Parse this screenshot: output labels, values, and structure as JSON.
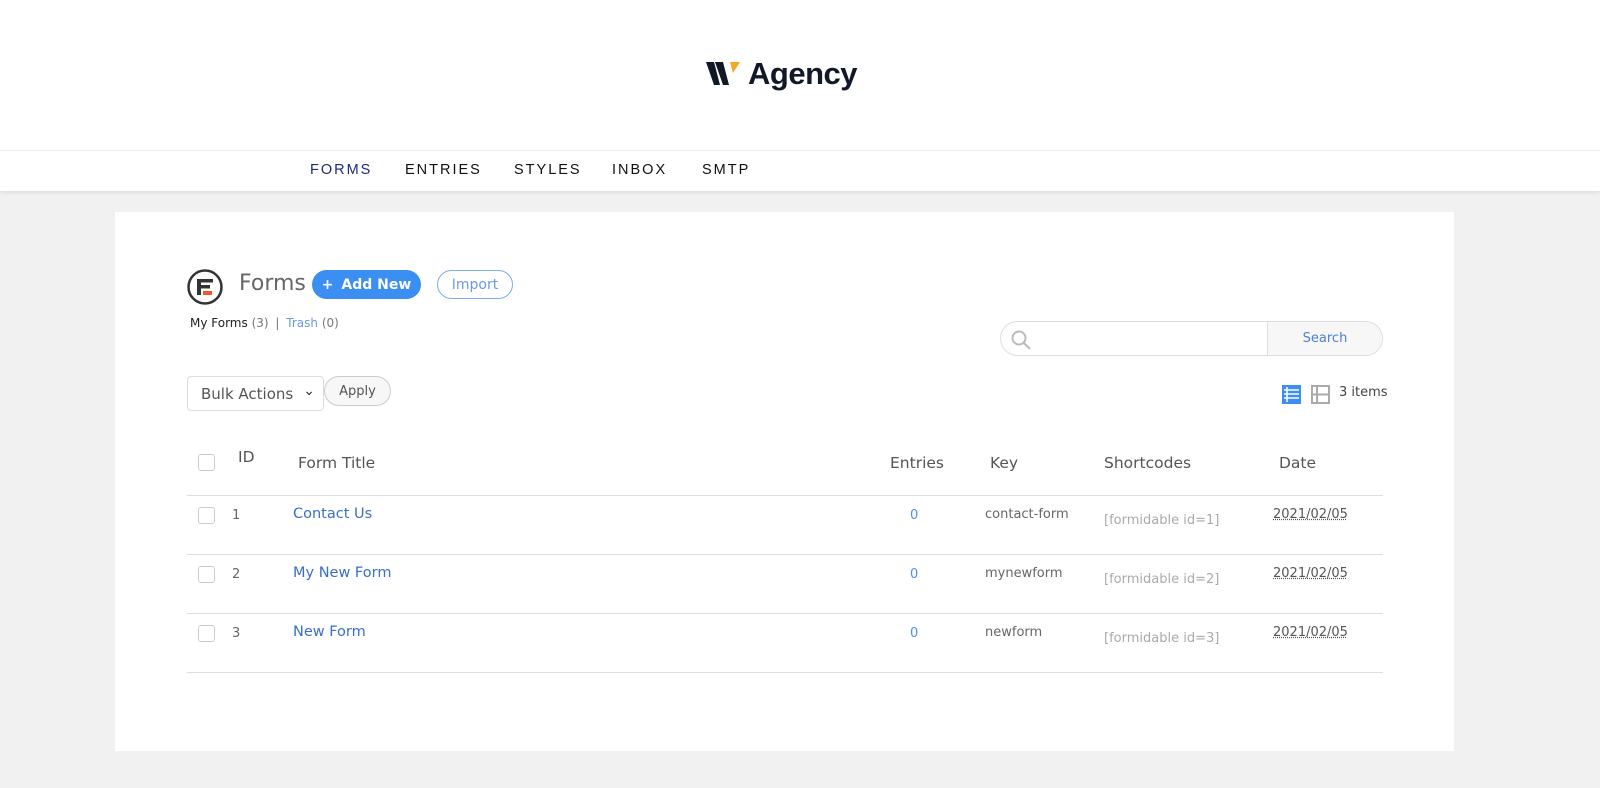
{
  "brand": {
    "name": "Agency",
    "accent": "#f5a623"
  },
  "nav": [
    "FORMS",
    "ENTRIES",
    "STYLES",
    "INBOX",
    "SMTP"
  ],
  "nav_active_color": "#1e2a78",
  "header": {
    "title": "Forms",
    "add_new": "Add New",
    "import": "Import"
  },
  "views": {
    "my_forms": "My Forms",
    "my_count": "(3)",
    "sep": "|",
    "trash": "Trash",
    "trash_count": "(0)"
  },
  "search": {
    "placeholder": "",
    "button": "Search"
  },
  "bulk": {
    "selected": "Bulk Actions",
    "apply": "Apply"
  },
  "items_count": "3 items",
  "columns": [
    "ID",
    "Form Title",
    "Entries",
    "Key",
    "Shortcodes",
    "Date"
  ],
  "rows": [
    {
      "id": "1",
      "title": "Contact Us",
      "entries": "0",
      "key": "contact-form",
      "shortcode": "[formidable id=1]",
      "date": "2021/02/05"
    },
    {
      "id": "2",
      "title": "My New Form",
      "entries": "0",
      "key": "mynewform",
      "shortcode": "[formidable id=2]",
      "date": "2021/02/05"
    },
    {
      "id": "3",
      "title": "New Form",
      "entries": "0",
      "key": "newform",
      "shortcode": "[formidable id=3]",
      "date": "2021/02/05"
    }
  ]
}
